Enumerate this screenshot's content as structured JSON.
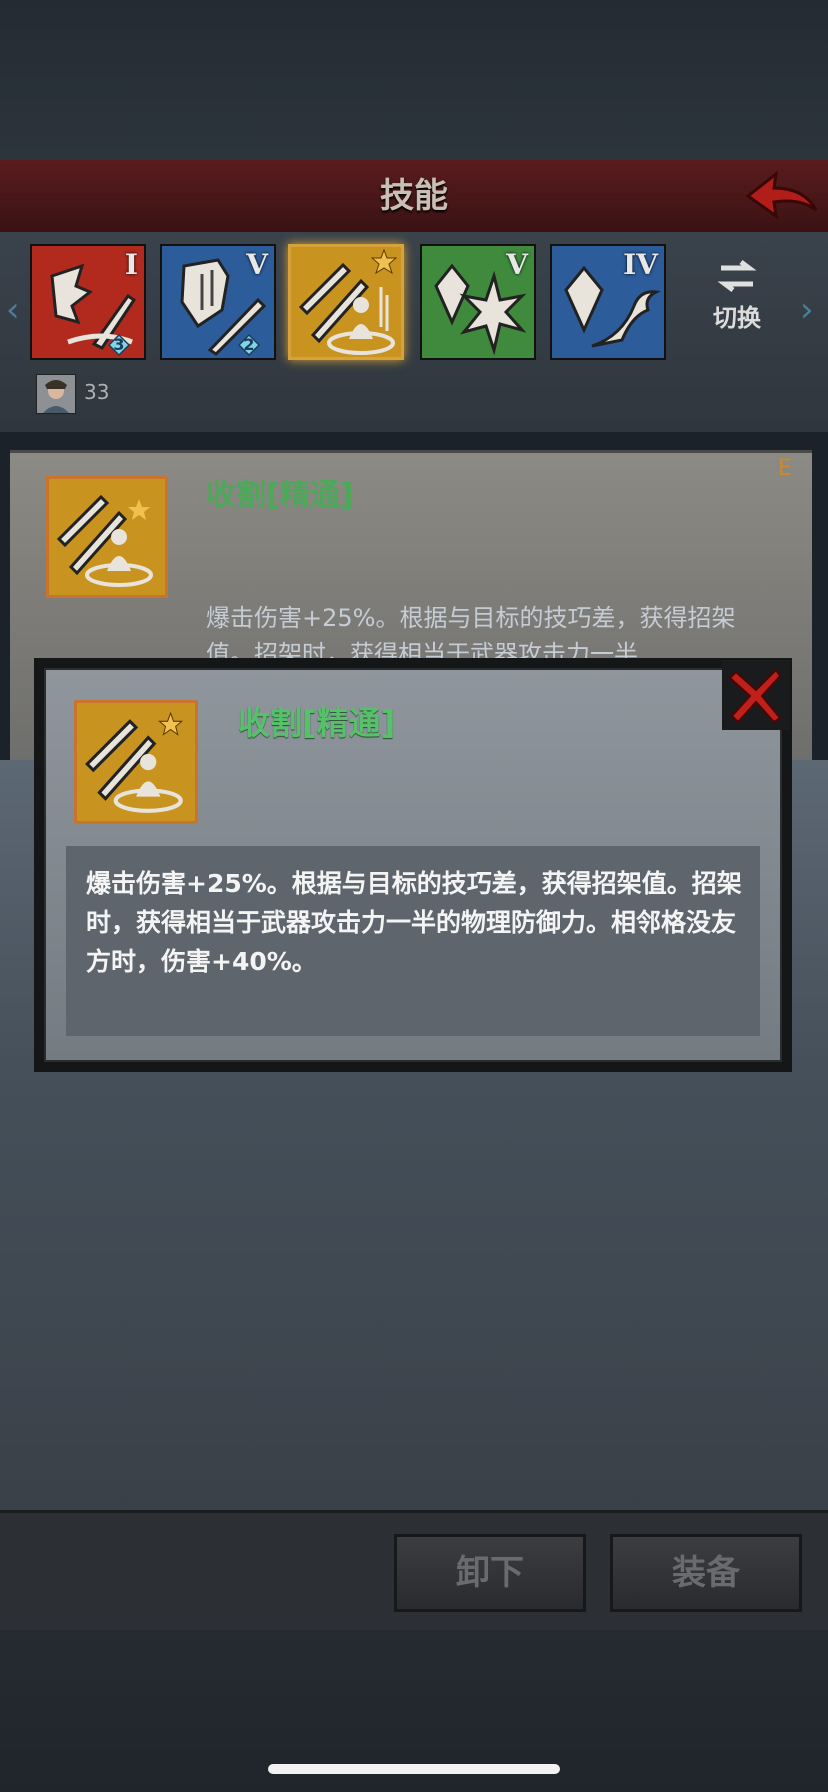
{
  "header": {
    "title": "技能"
  },
  "skills": [
    {
      "name": "skill-1",
      "rank": "I",
      "level": "3",
      "bg": "#b22a1e"
    },
    {
      "name": "skill-2",
      "rank": "V",
      "level": "2",
      "bg": "#2d5c9a"
    },
    {
      "name": "skill-3",
      "rank": "",
      "level": "",
      "bg": "#c8931e",
      "selected": true
    },
    {
      "name": "skill-4",
      "rank": "V",
      "level": "",
      "bg": "#3f8a3c"
    },
    {
      "name": "skill-5",
      "rank": "IV",
      "level": "",
      "bg": "#2d5c9a"
    }
  ],
  "switch": {
    "label": "切换"
  },
  "hero": {
    "count": "33"
  },
  "detail": {
    "title": "收割[精通]",
    "desc_partial": "爆击伤害+25%。根据与目标的技巧差，获得招架值。招架时，获得相当于武器攻击力一半",
    "corner": "E"
  },
  "popup": {
    "title": "收割[精通]",
    "desc": "爆击伤害+25%。根据与目标的技巧差，获得招架值。招架时，获得相当于武器攻击力一半的物理防御力。相邻格没友方时，伤害+40%。"
  },
  "actions": {
    "unequip": "卸下",
    "equip": "装备"
  },
  "colors": {
    "accent": "#d8a23a",
    "title_green": "#57c06a",
    "header_red": "#5a1c1e",
    "close_red": "#c0201a"
  }
}
